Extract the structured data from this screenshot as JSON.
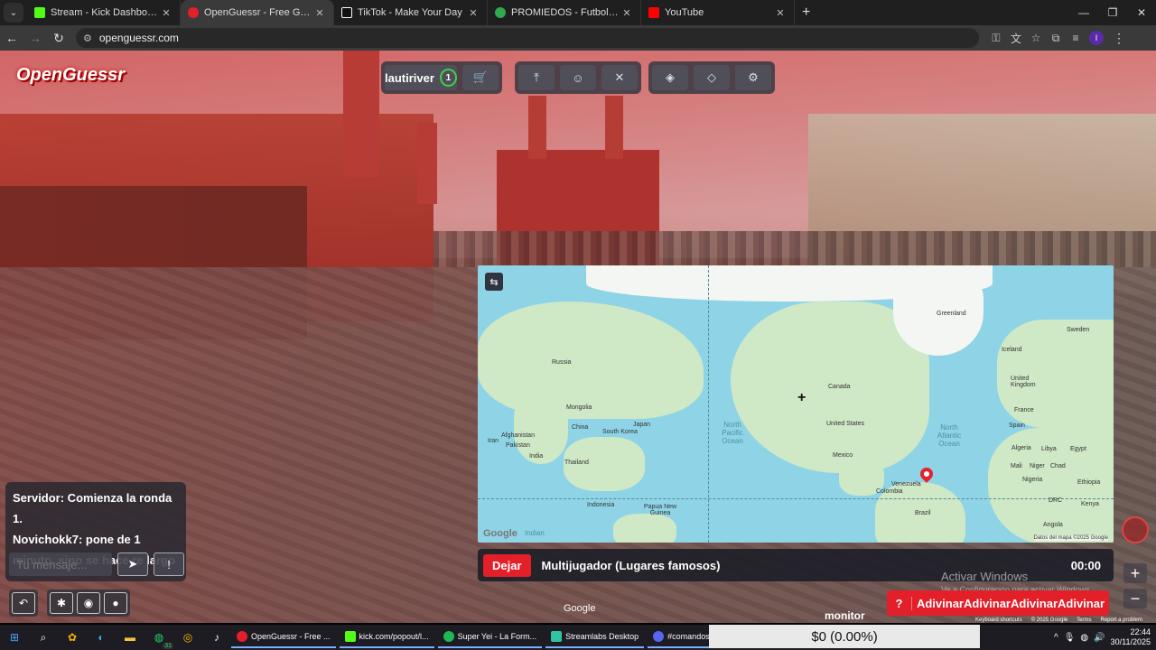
{
  "browser": {
    "tabs": [
      {
        "title": "Stream - Kick Dashboard",
        "favicon_color": "#53fc18",
        "active": false
      },
      {
        "title": "OpenGuessr - Free GeoGuessr",
        "favicon_color": "#e3202a",
        "active": true
      },
      {
        "title": "TikTok - Make Your Day",
        "favicon_color": "#111111",
        "active": false
      },
      {
        "title": "PROMIEDOS - Futbol Argentino",
        "favicon_color": "#2fa84f",
        "active": false
      },
      {
        "title": "YouTube",
        "favicon_color": "#ff0000",
        "active": false
      }
    ],
    "url": "openguessr.com",
    "profile_initial": "I"
  },
  "game": {
    "logo": "OpenGuessr",
    "username": "lautiriver",
    "level": "1",
    "colors": {
      "accent": "#e3202a",
      "level_ring": "#3ecf4a"
    }
  },
  "map": {
    "labels": {
      "greenland": "Greenland",
      "iceland": "Iceland",
      "sweden": "Sweden",
      "canada": "Canada",
      "russia": "Russia",
      "mongolia": "Mongolia",
      "china": "China",
      "japan": "Japan",
      "south_korea": "South Korea",
      "afghanistan": "Afghanistan",
      "iran": "Iran",
      "pakistan": "Pakistan",
      "india": "India",
      "thailand": "Thailand",
      "indonesia": "Indonesia",
      "papua": "Papua New Guinea",
      "united_states": "United States",
      "mexico": "Mexico",
      "venezuela": "Venezuela",
      "colombia": "Colombia",
      "brazil": "Brazil",
      "united_kingdom": "United Kingdom",
      "france": "France",
      "spain": "Spain",
      "algeria": "Algeria",
      "libya": "Libya",
      "egypt": "Egypt",
      "mali": "Mali",
      "niger": "Niger",
      "chad": "Chad",
      "nigeria": "Nigeria",
      "ethiopia": "Ethiopia",
      "drc": "DRC",
      "angola": "Angola",
      "kenya": "Kenya",
      "north_pacific": "North Pacific Ocean",
      "north_atlantic": "North Atlantic Ocean",
      "indian": "Indian",
      "google": "Google",
      "attribution": "Datos del mapa ©2025 Google"
    }
  },
  "map_bar": {
    "leave_label": "Dejar",
    "mode_label": "Multijugador (Lugares famosos)",
    "timer": "00:00"
  },
  "chat": {
    "messages": [
      "Servidor: Comienza la ronda 1.",
      "Novichokk7: pone de 1 minuto, sino se hace re largo"
    ],
    "input_placeholder": "Tu mensaje..."
  },
  "overlay": {
    "google_label": "Google",
    "activate_title": "Activar Windows",
    "activate_sub": "Ve a Configuración para activar Windows.",
    "guess_label": "AdivinarAdivinarAdivinarAdivinar",
    "guess_icon": "?",
    "footer_links": [
      "Keyboard shortcuts",
      "© 2025 Google",
      "Terms",
      "Report a problem"
    ]
  },
  "taskbar": {
    "apps": [
      {
        "label": "OpenGuessr - Free ...",
        "color": "#e3202a"
      },
      {
        "label": "kick.com/popout/l...",
        "color": "#53fc18"
      },
      {
        "label": "Super Yei - La Form...",
        "color": "#1db954"
      },
      {
        "label": "Streamlabs Desktop",
        "color": "#31c3a2"
      },
      {
        "label": "#comandos | rivero",
        "color": "#5865f2"
      }
    ],
    "whatsapp_badge": "31",
    "monitor_label": "monitor",
    "monitor_value": "$0 (0.00%)",
    "time": "22:44",
    "date": "30/11/2025"
  }
}
